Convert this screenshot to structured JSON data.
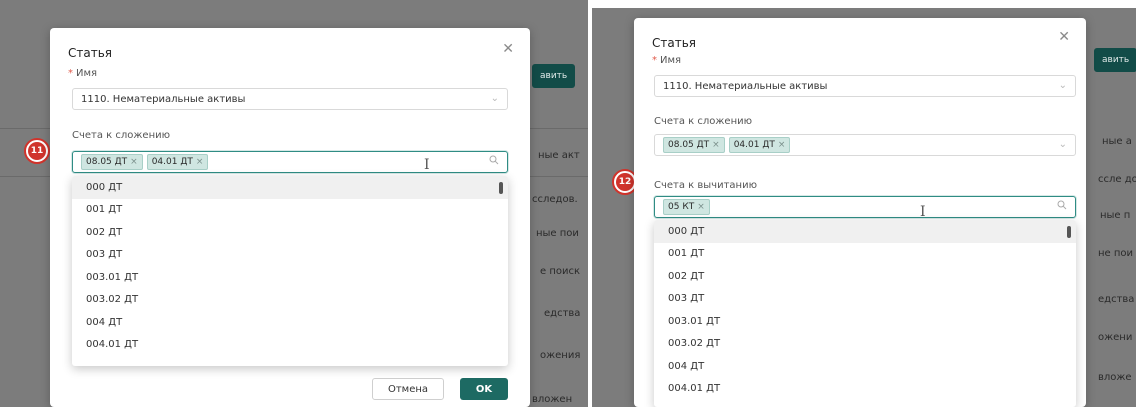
{
  "left": {
    "background": {
      "button_fragment": "авить",
      "rows": [
        "ные акт",
        "сследов.",
        "ные пои",
        "е поиск",
        "едства",
        "ожения",
        "вложен"
      ]
    },
    "dialog": {
      "title": "Статья",
      "name_required_mark": "*",
      "name_label": "Имя",
      "name_value": "1110. Нематериальные активы",
      "add_label": "Счета к сложению",
      "add_tags": [
        "08.05 ДТ",
        "04.01 ДТ"
      ],
      "cancel_label": "Отмена",
      "ok_label": "OK"
    },
    "badge": "11",
    "dropdown": [
      "000 ДТ",
      "001 ДТ",
      "002 ДТ",
      "003 ДТ",
      "003.01 ДТ",
      "003.02 ДТ",
      "004 ДТ",
      "004.01 ДТ"
    ]
  },
  "right": {
    "background": {
      "button_fragment": "авить",
      "rows": [
        "ные а",
        "ссле до",
        "ные п",
        "не пои",
        "едства",
        "ожени",
        "вложе"
      ]
    },
    "dialog": {
      "title": "Статья",
      "name_required_mark": "*",
      "name_label": "Имя",
      "name_value": "1110. Нематериальные активы",
      "add_label": "Счета к сложению",
      "add_tags": [
        "08.05 ДТ",
        "04.01 ДТ"
      ],
      "sub_label": "Счета к вычитанию",
      "sub_tags": [
        "05 КТ"
      ]
    },
    "badge": "12",
    "dropdown": [
      "000 ДТ",
      "001 ДТ",
      "002 ДТ",
      "003 ДТ",
      "003.01 ДТ",
      "003.02 ДТ",
      "004 ДТ",
      "004.01 ДТ"
    ]
  },
  "colors": {
    "accent": "#1d6a63",
    "tag_bg": "#cfe6e1",
    "badge": "#d0342c",
    "overlay": "#7c7c7c"
  },
  "icons": {
    "close": "close-icon",
    "chevron": "chevron-down-icon",
    "search": "search-icon",
    "tag_remove": "close-icon"
  }
}
